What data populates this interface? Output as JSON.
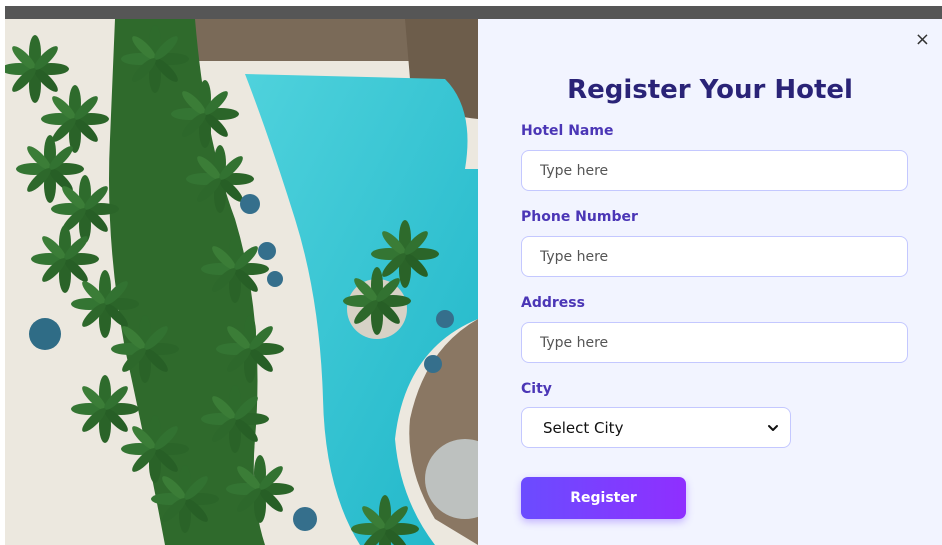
{
  "modal": {
    "title": "Register Your Hotel",
    "close_symbol": "×",
    "image": {
      "description_icon": "resort-pool-aerial-image"
    }
  },
  "form": {
    "fields": [
      {
        "label": "Hotel Name",
        "placeholder": "Type here",
        "value": ""
      },
      {
        "label": "Phone Number",
        "placeholder": "Type here",
        "value": ""
      },
      {
        "label": "Address",
        "placeholder": "Type here",
        "value": ""
      }
    ],
    "city": {
      "label": "City",
      "selected": "Select City"
    },
    "submit_label": "Register"
  },
  "colors": {
    "title": "#2a2377",
    "label": "#4b36b6",
    "button_start": "#6b4cff",
    "button_end": "#8f2fff",
    "panel_bg": "#f2f4ff"
  }
}
